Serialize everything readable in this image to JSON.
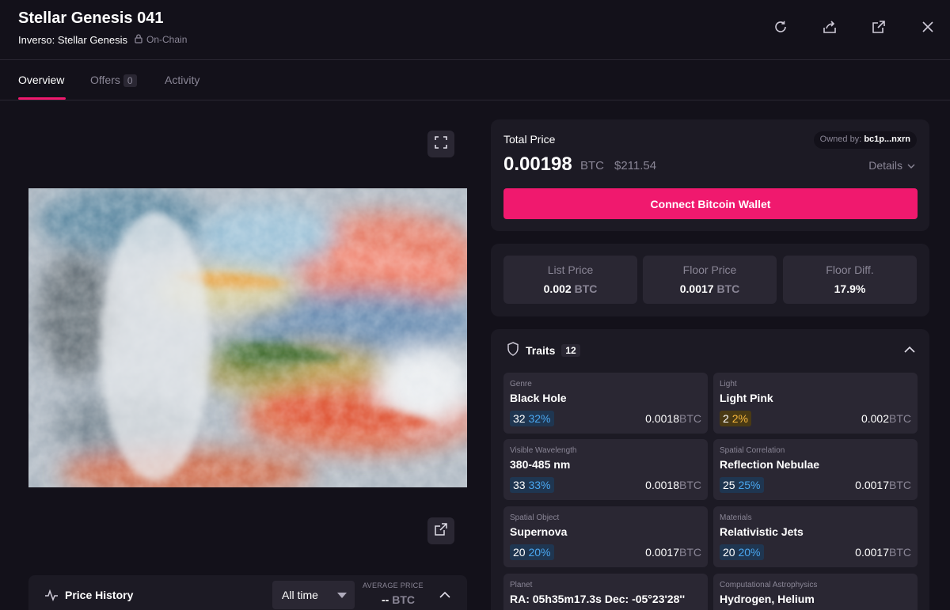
{
  "header": {
    "title": "Stellar Genesis 041",
    "collection": "Inverso: Stellar Genesis",
    "chain_label": "On-Chain"
  },
  "tabs": [
    {
      "label": "Overview"
    },
    {
      "label": "Offers",
      "count": "0"
    },
    {
      "label": "Activity"
    }
  ],
  "buy": {
    "total_label": "Total Price",
    "price": "0.00198",
    "unit": "BTC",
    "usd": "$211.54",
    "owned_label": "Owned by:",
    "owner": "bc1p...nxrn",
    "details_label": "Details",
    "connect_label": "Connect Bitcoin Wallet"
  },
  "stats": [
    {
      "label": "List Price",
      "value": "0.002",
      "unit": "BTC"
    },
    {
      "label": "Floor Price",
      "value": "0.0017",
      "unit": "BTC"
    },
    {
      "label": "Floor Diff.",
      "value": "17.9%",
      "unit": ""
    }
  ],
  "traits": {
    "label": "Traits",
    "count": "12",
    "items": [
      {
        "key": "Genre",
        "value": "Black Hole",
        "count": "32",
        "pct": "32%",
        "price": "0.0018",
        "unit": "BTC"
      },
      {
        "key": "Light",
        "value": "Light Pink",
        "count": "2",
        "pct": "2%",
        "price": "0.002",
        "unit": "BTC"
      },
      {
        "key": "Visible Wavelength",
        "value": "380-485 nm",
        "count": "33",
        "pct": "33%",
        "price": "0.0018",
        "unit": "BTC"
      },
      {
        "key": "Spatial Correlation",
        "value": "Reflection Nebulae",
        "count": "25",
        "pct": "25%",
        "price": "0.0017",
        "unit": "BTC"
      },
      {
        "key": "Spatial Object",
        "value": "Supernova",
        "count": "20",
        "pct": "20%",
        "price": "0.0017",
        "unit": "BTC"
      },
      {
        "key": "Materials",
        "value": "Relativistic Jets",
        "count": "20",
        "pct": "20%",
        "price": "0.0017",
        "unit": "BTC"
      },
      {
        "key": "Planet",
        "value": "RA: 05h35m17.3s Dec: -05°23'28''"
      },
      {
        "key": "Computational Astrophysics",
        "value": "Hydrogen, Helium"
      }
    ]
  },
  "price_history": {
    "title": "Price History",
    "range": "All time",
    "avg_label": "AVERAGE PRICE",
    "avg_value": "--",
    "avg_unit": "BTC"
  },
  "colors": {
    "accent": "#f0196e",
    "background": "#13111a",
    "card": "#1c1a24",
    "tile": "#2a2733",
    "rarity_blue": "#4aa6ef",
    "rarity_gold": "#f6b73c"
  }
}
